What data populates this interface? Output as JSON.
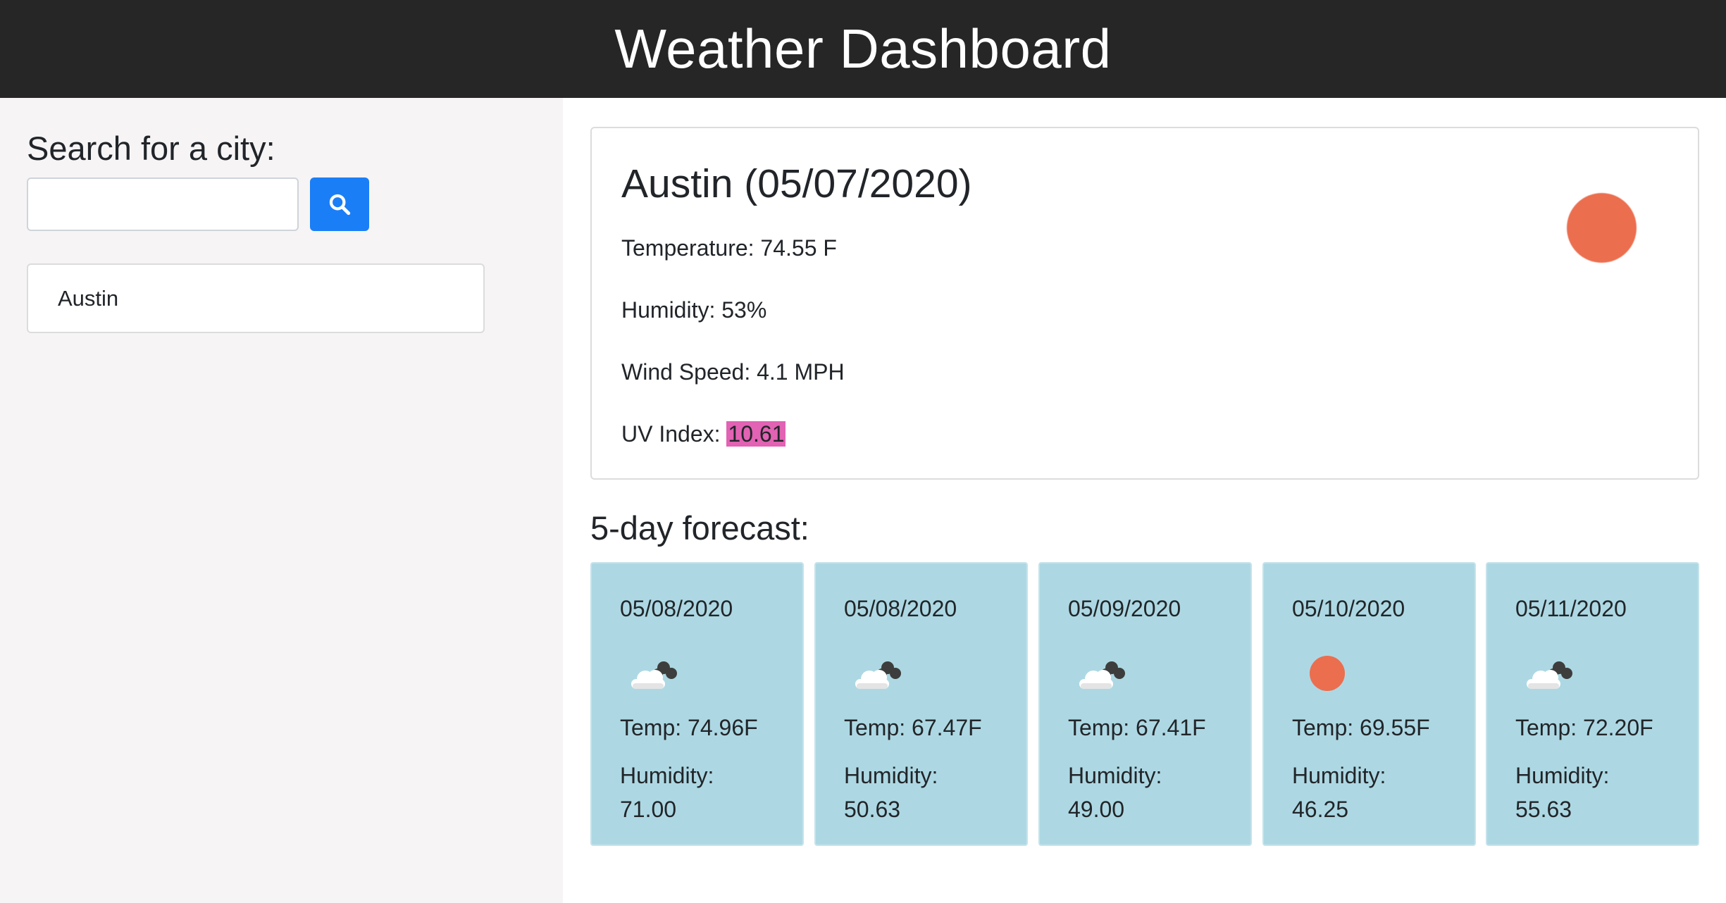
{
  "header": {
    "title": "Weather Dashboard"
  },
  "sidebar": {
    "search_label": "Search for a city:",
    "search_value": "",
    "search_button_icon": "search-icon",
    "history": [
      {
        "label": "Austin"
      }
    ]
  },
  "current": {
    "title": "Austin (05/07/2020)",
    "temperature": "Temperature: 74.55 F",
    "humidity": "Humidity: 53%",
    "wind": "Wind Speed: 4.1 MPH",
    "uv_label": "UV Index: ",
    "uv_value": "10.61",
    "icon": "sun-icon"
  },
  "forecast": {
    "heading": "5-day forecast:",
    "days": [
      {
        "date": "05/08/2020",
        "icon": "cloud-icon",
        "temp": "Temp: 74.96F",
        "humidity_label": "Humidity:",
        "humidity": "71.00"
      },
      {
        "date": "05/08/2020",
        "icon": "cloud-icon",
        "temp": "Temp: 67.47F",
        "humidity_label": "Humidity:",
        "humidity": "50.63"
      },
      {
        "date": "05/09/2020",
        "icon": "cloud-icon",
        "temp": "Temp: 67.41F",
        "humidity_label": "Humidity:",
        "humidity": "49.00"
      },
      {
        "date": "05/10/2020",
        "icon": "sun-icon",
        "temp": "Temp: 69.55F",
        "humidity_label": "Humidity:",
        "humidity": "46.25"
      },
      {
        "date": "05/11/2020",
        "icon": "cloud-icon",
        "temp": "Temp: 72.20F",
        "humidity_label": "Humidity:",
        "humidity": "55.63"
      }
    ]
  },
  "colors": {
    "header_bg": "#262626",
    "sidebar_bg": "#f6f4f5",
    "search_button": "#1a7ef7",
    "uv_highlight": "#e262b3",
    "sun": "#eb6e4f",
    "forecast_card": "#add8e3"
  }
}
